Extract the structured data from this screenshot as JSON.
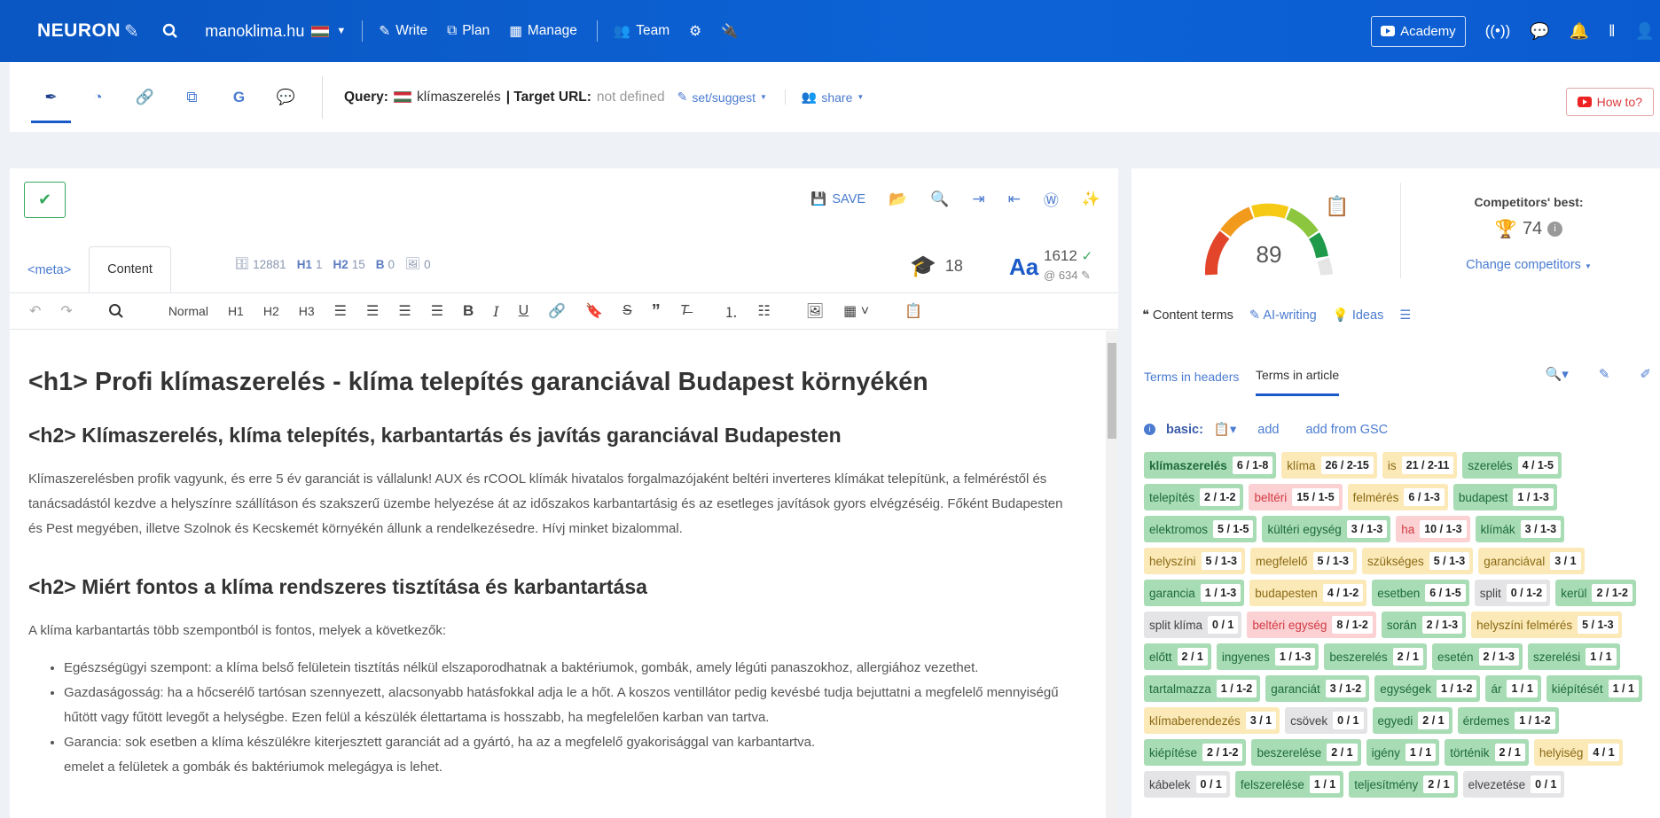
{
  "nav": {
    "brand": "NEURON",
    "site": "manoklima.hu",
    "links": [
      "Write",
      "Plan",
      "Manage",
      "Team"
    ],
    "academy": "Academy"
  },
  "subbar": {
    "query_label": "Query:",
    "query_value": "klímaszerelés",
    "target_label": "| Target URL:",
    "target_value": "not defined",
    "set_suggest": "set/suggest",
    "share": "share",
    "howto": "How to?"
  },
  "editor": {
    "save_label": "SAVE",
    "tabs": [
      "<meta>",
      "Content"
    ],
    "stats": {
      "words": "12881",
      "h1": "1",
      "h2": "15",
      "b": "0",
      "img": "0"
    },
    "readability": "18",
    "word_count": "1612",
    "char_count": "634",
    "toolbar": {
      "normal": "Normal",
      "h1": "H1",
      "h2": "H2",
      "h3": "H3"
    },
    "content": {
      "h1": "<h1> Profi klímaszerelés - klíma telepítés garanciával Budapest környékén",
      "h2a": "<h2> Klímaszerelés, klíma telepítés, karbantartás és javítás garanciával Budapesten",
      "p1": "Klímaszerelésben profik vagyunk, és erre 5 év garanciát is vállalunk! AUX és rCOOL klímák hivatalos forgalmazójaként beltéri inverteres klímákat telepítünk, a felméréstől és tanácsadástól kezdve a helyszínre szállításon és szakszerű üzembe helyezése át az időszakos karbantartásig és az esetleges javítások gyors elvégzéséig. Főként Budapesten és Pest megyében, illetve Szolnok és Kecskemét környékén állunk a rendelkezésedre. Hívj minket bizalommal.",
      "h2b": "<h2> Miért fontos a klíma rendszeres tisztítása és karbantartása",
      "p2": "A klíma karbantartás több szempontból is fontos, melyek a következők:",
      "li1": "Egészségügyi szempont: a klíma belső felületein tisztítás nélkül elszaporodhatnak a baktériumok, gombák, amely légúti panaszokhoz, allergiához vezethet.",
      "li2": "Gazdaságosság: ha a hőcserélő tartósan szennyezett, alacsonyabb hatásfokkal adja le a hőt. A koszos ventillátor pedig kevésbé tudja bejuttatni a megfelelő mennyiségű hűtött vagy fűtött levegőt a helységbe. Ezen felül a készülék élettartama is hosszabb, ha megfelelően karban van tartva.",
      "li3a": "Garancia: sok esetben a klíma készülékre kiterjesztett garanciát ad a gyártó, ha az a megfelelő gyakorisággal van karbantartva.",
      "li3b": "emelet a felületek a gombák és baktériumok melegágya is lehet."
    }
  },
  "score": {
    "value": 89,
    "competitors_label": "Competitors' best:",
    "competitors_value": "74",
    "change_competitors": "Change competitors"
  },
  "rtabs": [
    "Content terms",
    "AI-writing",
    "Ideas"
  ],
  "subtabs": [
    "Terms in headers",
    "Terms in article"
  ],
  "basic": {
    "label": "basic:",
    "add": "add",
    "add_gsc": "add from GSC"
  },
  "terms": [
    {
      "t": "klímaszerelés",
      "c": "6 / 1-8",
      "k": "green bold"
    },
    {
      "t": "klíma",
      "c": "26 / 2-15",
      "k": "yellow"
    },
    {
      "t": "is",
      "c": "21 / 2-11",
      "k": "yellow"
    },
    {
      "t": "szerelés",
      "c": "4 / 1-5",
      "k": "green"
    },
    {
      "t": "telepítés",
      "c": "2 / 1-2",
      "k": "green"
    },
    {
      "t": "beltéri",
      "c": "15 / 1-5",
      "k": "red"
    },
    {
      "t": "felmérés",
      "c": "6 / 1-3",
      "k": "yellow"
    },
    {
      "t": "budapest",
      "c": "1 / 1-3",
      "k": "green"
    },
    {
      "t": "elektromos",
      "c": "5 / 1-5",
      "k": "green"
    },
    {
      "t": "kültéri egység",
      "c": "3 / 1-3",
      "k": "green"
    },
    {
      "t": "ha",
      "c": "10 / 1-3",
      "k": "red"
    },
    {
      "t": "klímák",
      "c": "3 / 1-3",
      "k": "green"
    },
    {
      "t": "helyszíni",
      "c": "5 / 1-3",
      "k": "yellow"
    },
    {
      "t": "megfelelő",
      "c": "5 / 1-3",
      "k": "yellow"
    },
    {
      "t": "szükséges",
      "c": "5 / 1-3",
      "k": "yellow"
    },
    {
      "t": "garanciával",
      "c": "3 / 1",
      "k": "yellow"
    },
    {
      "t": "garancia",
      "c": "1 / 1-3",
      "k": "green"
    },
    {
      "t": "budapesten",
      "c": "4 / 1-2",
      "k": "yellow"
    },
    {
      "t": "esetben",
      "c": "6 / 1-5",
      "k": "green"
    },
    {
      "t": "split",
      "c": "0 / 1-2",
      "k": "gray"
    },
    {
      "t": "kerül",
      "c": "2 / 1-2",
      "k": "green"
    },
    {
      "t": "split klíma",
      "c": "0 / 1",
      "k": "gray"
    },
    {
      "t": "beltéri egység",
      "c": "8 / 1-2",
      "k": "red"
    },
    {
      "t": "során",
      "c": "2 / 1-3",
      "k": "green"
    },
    {
      "t": "helyszíni felmérés",
      "c": "5 / 1-3",
      "k": "yellow"
    },
    {
      "t": "előtt",
      "c": "2 / 1",
      "k": "green"
    },
    {
      "t": "ingyenes",
      "c": "1 / 1-3",
      "k": "green"
    },
    {
      "t": "beszerelés",
      "c": "2 / 1",
      "k": "green"
    },
    {
      "t": "esetén",
      "c": "2 / 1-3",
      "k": "green"
    },
    {
      "t": "szerelési",
      "c": "1 / 1",
      "k": "green"
    },
    {
      "t": "tartalmazza",
      "c": "1 / 1-2",
      "k": "green"
    },
    {
      "t": "garanciát",
      "c": "3 / 1-2",
      "k": "green"
    },
    {
      "t": "egységek",
      "c": "1 / 1-2",
      "k": "green"
    },
    {
      "t": "ár",
      "c": "1 / 1",
      "k": "green"
    },
    {
      "t": "kiépítését",
      "c": "1 / 1",
      "k": "green"
    },
    {
      "t": "klímaberendezés",
      "c": "3 / 1",
      "k": "yellow"
    },
    {
      "t": "csövek",
      "c": "0 / 1",
      "k": "gray"
    },
    {
      "t": "egyedi",
      "c": "2 / 1",
      "k": "green"
    },
    {
      "t": "érdemes",
      "c": "1 / 1-2",
      "k": "green"
    },
    {
      "t": "kiépítése",
      "c": "2 / 1-2",
      "k": "green"
    },
    {
      "t": "beszerelése",
      "c": "2 / 1",
      "k": "green"
    },
    {
      "t": "igény",
      "c": "1 / 1",
      "k": "green"
    },
    {
      "t": "történik",
      "c": "2 / 1",
      "k": "green"
    },
    {
      "t": "helyiség",
      "c": "4 / 1",
      "k": "yellow"
    },
    {
      "t": "kábelek",
      "c": "0 / 1",
      "k": "gray"
    },
    {
      "t": "felszerelése",
      "c": "1 / 1",
      "k": "green"
    },
    {
      "t": "teljesítmény",
      "c": "2 / 1",
      "k": "green"
    },
    {
      "t": "elvezetése",
      "c": "0 / 1",
      "k": "gray"
    }
  ]
}
